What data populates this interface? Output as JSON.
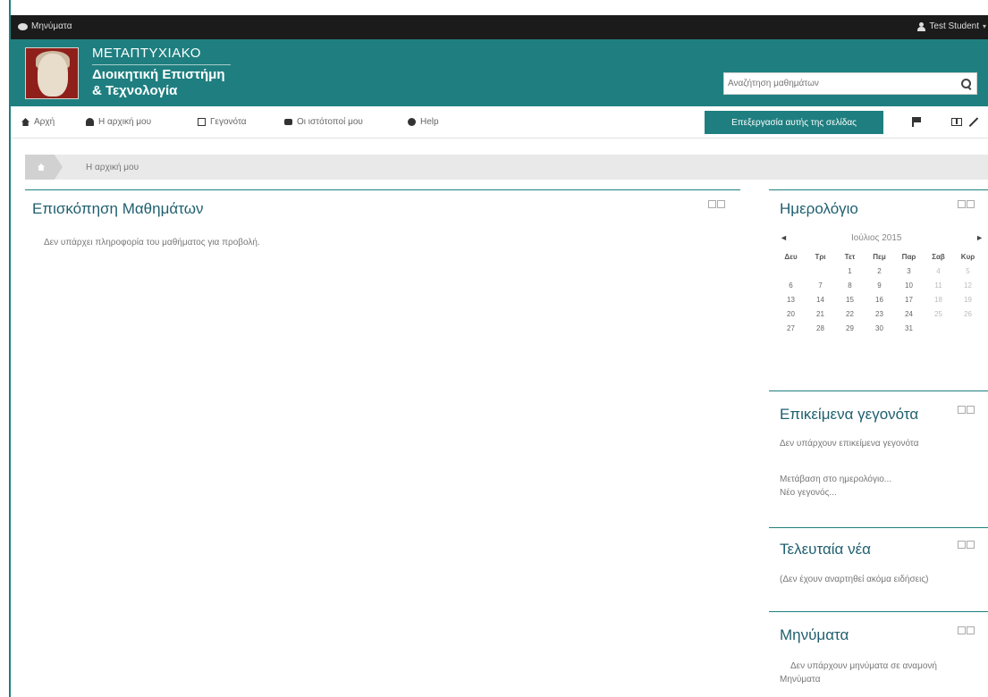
{
  "topbar": {
    "messages_label": "Μηνύματα",
    "user_name": "Test Student"
  },
  "header": {
    "brand_line1": "ΜΕΤΑΠΤΥΧΙΑΚΟ",
    "brand_line2": "Διοικητική Επιστήμη",
    "brand_line3": "& Τεχνολογία",
    "search_placeholder": "Αναζήτηση μαθημάτων"
  },
  "nav": {
    "items": [
      {
        "label": "Αρχή",
        "icon": "home-icon"
      },
      {
        "label": "Η αρχική μου",
        "icon": "dashboard-icon"
      },
      {
        "label": "Γεγονότα",
        "icon": "calendar-icon"
      },
      {
        "label": "Οι ιστότοποί μου",
        "icon": "users-icon"
      },
      {
        "label": "Help",
        "icon": "help-icon"
      }
    ],
    "edit_button": "Επεξεργασία αυτής της σελίδας"
  },
  "breadcrumb": {
    "current": "Η αρχική μου"
  },
  "overview": {
    "title": "Επισκόπηση Μαθημάτων",
    "empty": "Δεν υπάρχει πληροφορία του μαθήματος για προβολή."
  },
  "calendar": {
    "title": "Ημερολόγιο",
    "prev": "◄",
    "next": "►",
    "month": "Ιούλιος 2015",
    "days": [
      "Δευ",
      "Τρι",
      "Τετ",
      "Πεμ",
      "Παρ",
      "Σαβ",
      "Κυρ"
    ],
    "weeks": [
      [
        "",
        "",
        "1",
        "2",
        "3",
        "4",
        "5"
      ],
      [
        "6",
        "7",
        "8",
        "9",
        "10",
        "11",
        "12"
      ],
      [
        "13",
        "14",
        "15",
        "16",
        "17",
        "18",
        "19"
      ],
      [
        "20",
        "21",
        "22",
        "23",
        "24",
        "25",
        "26"
      ],
      [
        "27",
        "28",
        "29",
        "30",
        "31",
        "",
        ""
      ]
    ]
  },
  "events": {
    "title": "Επικείμενα γεγονότα",
    "empty": "Δεν υπάρχουν επικείμενα γεγονότα",
    "goto_calendar": "Μετάβαση στο ημερολόγιο...",
    "new_event": "Νέο γεγονός..."
  },
  "news": {
    "title": "Τελευταία νέα",
    "empty": "(Δεν έχουν αναρτηθεί ακόμα ειδήσεις)"
  },
  "messages": {
    "title": "Μηνύματα",
    "empty": "Δεν υπάρχουν μηνύματα σε αναμονή",
    "link": "Μηνύματα"
  }
}
